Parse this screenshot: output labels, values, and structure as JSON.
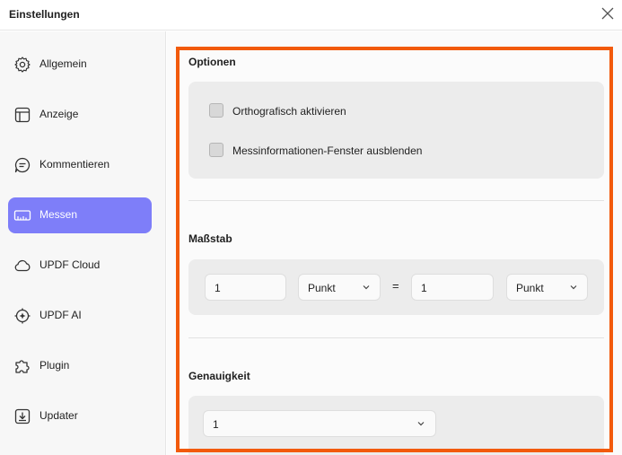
{
  "window": {
    "title": "Einstellungen",
    "close_icon": "close-icon"
  },
  "sidebar": {
    "items": [
      {
        "label": "Allgemein",
        "icon": "gear-icon"
      },
      {
        "label": "Anzeige",
        "icon": "layout-icon"
      },
      {
        "label": "Kommentieren",
        "icon": "comment-icon"
      },
      {
        "label": "Messen",
        "icon": "ruler-icon",
        "active": true
      },
      {
        "label": "UPDF Cloud",
        "icon": "cloud-icon"
      },
      {
        "label": "UPDF AI",
        "icon": "ai-icon"
      },
      {
        "label": "Plugin",
        "icon": "puzzle-icon"
      },
      {
        "label": "Updater",
        "icon": "download-icon"
      }
    ]
  },
  "main": {
    "optionen": {
      "title": "Optionen",
      "checkboxes": [
        {
          "label": "Orthografisch aktivieren",
          "checked": false
        },
        {
          "label": "Messinformationen-Fenster ausblenden",
          "checked": false
        }
      ]
    },
    "massstab": {
      "title": "Maßstab",
      "left_value": "1",
      "left_unit": "Punkt",
      "equals": "=",
      "right_value": "1",
      "right_unit": "Punkt"
    },
    "genauigkeit": {
      "title": "Genauigkeit",
      "value": "1"
    }
  },
  "colors": {
    "accent": "#7e7ef9",
    "highlight": "#f25a0c"
  }
}
